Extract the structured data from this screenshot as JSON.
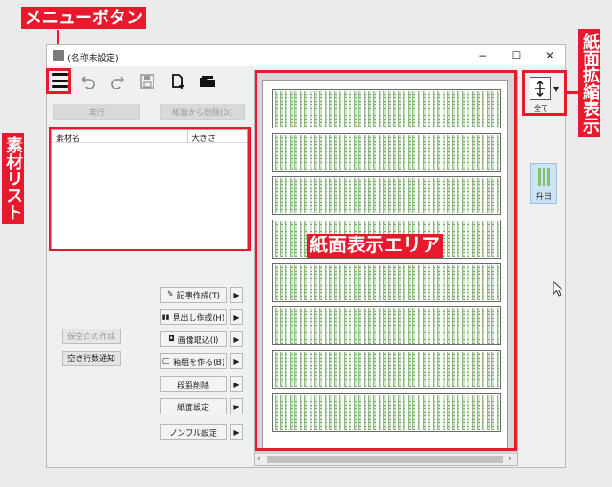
{
  "window": {
    "title": "(名称未設定)",
    "minimize": "−",
    "maximize": "☐",
    "close": "✕"
  },
  "toolbar": {
    "execute": "実行",
    "delete_from_page": "紙面から削除(D)"
  },
  "material_list": {
    "columns": [
      "素材名",
      "大きさ"
    ]
  },
  "side_buttons": {
    "temp_space": "仮空白の作成",
    "empty_lines": "空き行数通知"
  },
  "actions": [
    {
      "label": "記事作成(T)",
      "icon": "pencil-icon",
      "glyph": "✎"
    },
    {
      "label": "見出し作成(H)",
      "icon": "chart-icon",
      "glyph": "▮▮"
    },
    {
      "label": "画像取込(I)",
      "icon": "camera-icon",
      "glyph": "◘"
    },
    {
      "label": "箱組を作る(B)",
      "icon": "box-icon",
      "glyph": "▢"
    },
    {
      "label": "段罫削除",
      "icon": "",
      "glyph": ""
    },
    {
      "label": "紙面設定",
      "icon": "",
      "glyph": ""
    },
    {
      "label": "ノンブル設定",
      "icon": "",
      "glyph": ""
    }
  ],
  "right_panel": {
    "fit_label": "全て",
    "shoumoku_label": "升目"
  },
  "scroll": {
    "left": "‹",
    "right": "›"
  },
  "annotations": {
    "menu_button": "メニューボタン",
    "material_list": "素材リスト",
    "paper_area": "紙面表示エリア",
    "zoom": "紙面拡縮表示"
  },
  "colors": {
    "annotation": "#e8192c",
    "grid_green": "#cfe8c6"
  }
}
